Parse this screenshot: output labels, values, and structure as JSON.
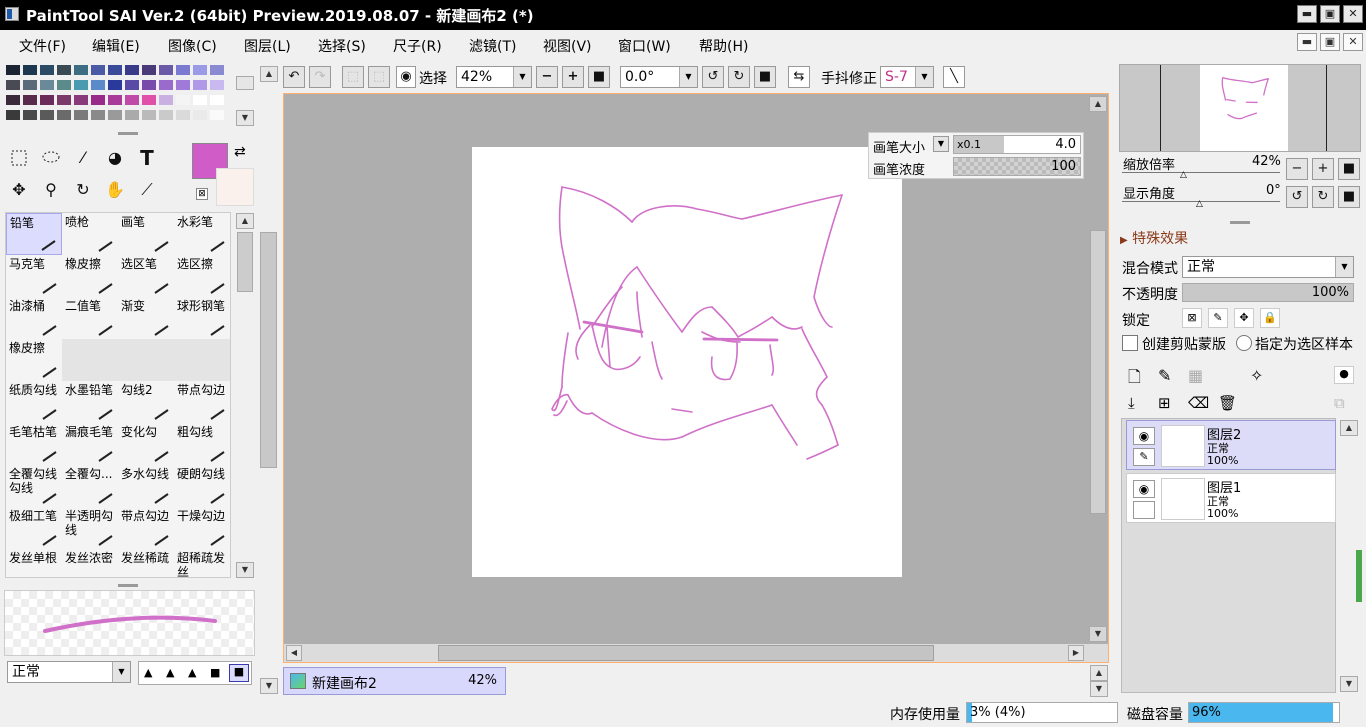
{
  "window": {
    "title": "PaintTool SAI Ver.2 (64bit) Preview.2019.08.07 - 新建画布2 (*)",
    "controls": {
      "minimize": "▬",
      "restore": "▣",
      "close": "✕"
    }
  },
  "menu": [
    "文件(F)",
    "编辑(E)",
    "图像(C)",
    "图层(L)",
    "选择(S)",
    "尺子(R)",
    "滤镜(T)",
    "视图(V)",
    "窗口(W)",
    "帮助(H)"
  ],
  "colors": {
    "primary": "#d05cc8",
    "secondary": "#fbf1ec",
    "stroke": "#d070c8",
    "accent_blue": "#4ab8ee",
    "selection": "#dcdcff"
  },
  "palette": [
    [
      "#1a2433",
      "#1b3850",
      "#2a4a66",
      "#3a4a55",
      "#3d6d82",
      "#4a5aa5",
      "#3a4a9a",
      "#3a3a8a",
      "#4a3a7a",
      "#6a5aa8",
      "#7a7ad0",
      "#9a9ae6",
      "#8a8ad2"
    ],
    [
      "#4a4a55",
      "#5a6a7a",
      "#6a8a9a",
      "#5a8a8a",
      "#4a9ab0",
      "#5a8aca",
      "#2a3a9a",
      "#5a4aa8",
      "#7a4aaa",
      "#9a6acc",
      "#a07ad8",
      "#b09ae8",
      "#c8baf0"
    ],
    [
      "#3a2a3a",
      "#5a2a4a",
      "#6a2a5a",
      "#7a3a6a",
      "#8a3a7a",
      "#9a2a8a",
      "#aa3a9a",
      "#c04aa8",
      "#e050a8",
      "#c8b0e0",
      "#f4f4f4",
      "#ffffff",
      "#ffffff"
    ],
    [
      "#3a3a3a",
      "#4a4a4a",
      "#5a5a5a",
      "#6a6a6a",
      "#7a7a7a",
      "#8a8a8a",
      "#9a9a9a",
      "#aaaaaa",
      "#bababa",
      "#cacaca",
      "#dadada",
      "#eaeaea",
      "#fafafa"
    ]
  ],
  "tools": [
    "select-rect",
    "lasso",
    "magic-wand",
    "fill-shape",
    "T",
    "move",
    "zoom",
    "rotate",
    "hand",
    "eyedropper"
  ],
  "brushes": [
    {
      "label": "铅笔",
      "selected": true
    },
    {
      "label": "喷枪"
    },
    {
      "label": "画笔"
    },
    {
      "label": "水彩笔"
    },
    {
      "label": "马克笔"
    },
    {
      "label": "橡皮擦"
    },
    {
      "label": "选区笔"
    },
    {
      "label": "选区擦"
    },
    {
      "label": "油漆桶"
    },
    {
      "label": "二值笔"
    },
    {
      "label": "渐变"
    },
    {
      "label": "球形钢笔"
    },
    {
      "label": "橡皮擦"
    },
    {
      "label": ""
    },
    {
      "label": ""
    },
    {
      "label": ""
    },
    {
      "label": "纸质勾线"
    },
    {
      "label": "水墨铅笔"
    },
    {
      "label": "勾线2"
    },
    {
      "label": "带点勾边"
    },
    {
      "label": "毛笔枯笔"
    },
    {
      "label": "漏痕毛笔"
    },
    {
      "label": "变化勾"
    },
    {
      "label": "粗勾线"
    },
    {
      "label": "全覆勾线勾线"
    },
    {
      "label": "全覆勾..."
    },
    {
      "label": "多水勾线"
    },
    {
      "label": "硬朗勾线"
    },
    {
      "label": "极细工笔"
    },
    {
      "label": "半透明勾线"
    },
    {
      "label": "带点勾边"
    },
    {
      "label": "干燥勾边"
    },
    {
      "label": "发丝单根"
    },
    {
      "label": "发丝浓密"
    },
    {
      "label": "发丝稀疏"
    },
    {
      "label": "超稀疏发丝"
    }
  ],
  "brush_settings": {
    "blend_mode": "正常",
    "size_label": "画笔大小",
    "size_multiplier": "x0.1",
    "size_value": "4.0",
    "density_label": "画笔浓度",
    "density_value": "100"
  },
  "toolbar": {
    "select_label": "选择",
    "zoom": "42%",
    "angle": "0.0°",
    "stabilizer_label": "手抖修正",
    "stabilizer_value": "S-7"
  },
  "document_tab": {
    "name": "新建画布2",
    "zoom": "42%"
  },
  "navigator": {
    "zoom_label": "缩放倍率",
    "zoom_value": "42%",
    "angle_label": "显示角度",
    "angle_value": "0°"
  },
  "layer_panel": {
    "effects_label": "特殊效果",
    "blend_label": "混合模式",
    "blend_value": "正常",
    "opacity_label": "不透明度",
    "opacity_value": "100%",
    "lock_label": "锁定",
    "clip_label": "创建剪贴蒙版",
    "sample_label": "指定为选区样本",
    "layers": [
      {
        "name": "图层2",
        "mode": "正常",
        "opacity": "100%",
        "selected": true
      },
      {
        "name": "图层1",
        "mode": "正常",
        "opacity": "100%",
        "selected": false
      }
    ]
  },
  "status": {
    "memory_label": "内存使用量",
    "memory_value": "3% (4%)",
    "disk_label": "磁盘容量",
    "disk_value": "96%",
    "disk_fraction": 0.96
  }
}
